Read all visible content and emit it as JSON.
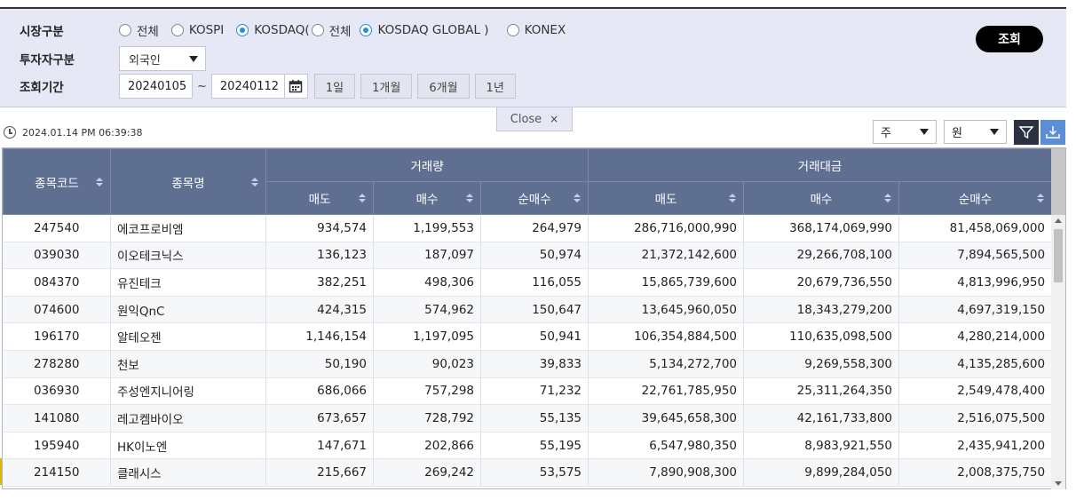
{
  "filters": {
    "market_label": "시장구분",
    "market_options": [
      {
        "label": "전체",
        "selected": false
      },
      {
        "label": "KOSPI",
        "selected": false
      },
      {
        "label": "KOSDAQ(",
        "selected": true
      },
      {
        "label": "전체",
        "selected": false
      },
      {
        "label": "KOSDAQ GLOBAL )",
        "selected": true
      },
      {
        "label": "KONEX",
        "selected": false
      }
    ],
    "investor_label": "투자자구분",
    "investor_value": "외국인",
    "period_label": "조회기간",
    "start_date": "20240105",
    "tilde": "~",
    "end_date": "20240112",
    "period_buttons": [
      "1일",
      "1개월",
      "6개월",
      "1년"
    ],
    "search_label": "조회"
  },
  "close_label": "Close",
  "close_symbol": "×",
  "timestamp": "2024.01.14 PM 06:39:38",
  "unit_period": "주",
  "unit_currency": "원",
  "table": {
    "headers": {
      "code": "종목코드",
      "name": "종목명",
      "volume_group": "거래량",
      "amount_group": "거래대금",
      "sell": "매도",
      "buy": "매수",
      "net": "순매수"
    },
    "rows": [
      {
        "code": "247540",
        "name": "에코프로비엠",
        "vol_sell": "934,574",
        "vol_buy": "1,199,553",
        "vol_net": "264,979",
        "amt_sell": "286,716,000,990",
        "amt_buy": "368,174,069,990",
        "amt_net": "81,458,069,000"
      },
      {
        "code": "039030",
        "name": "이오테크닉스",
        "vol_sell": "136,123",
        "vol_buy": "187,097",
        "vol_net": "50,974",
        "amt_sell": "21,372,142,600",
        "amt_buy": "29,266,708,100",
        "amt_net": "7,894,565,500"
      },
      {
        "code": "084370",
        "name": "유진테크",
        "vol_sell": "382,251",
        "vol_buy": "498,306",
        "vol_net": "116,055",
        "amt_sell": "15,865,739,600",
        "amt_buy": "20,679,736,550",
        "amt_net": "4,813,996,950"
      },
      {
        "code": "074600",
        "name": "원익QnC",
        "vol_sell": "424,315",
        "vol_buy": "574,962",
        "vol_net": "150,647",
        "amt_sell": "13,645,960,050",
        "amt_buy": "18,343,279,200",
        "amt_net": "4,697,319,150"
      },
      {
        "code": "196170",
        "name": "알테오젠",
        "vol_sell": "1,146,154",
        "vol_buy": "1,197,095",
        "vol_net": "50,941",
        "amt_sell": "106,354,884,500",
        "amt_buy": "110,635,098,500",
        "amt_net": "4,280,214,000"
      },
      {
        "code": "278280",
        "name": "천보",
        "vol_sell": "50,190",
        "vol_buy": "90,023",
        "vol_net": "39,833",
        "amt_sell": "5,134,272,700",
        "amt_buy": "9,269,558,300",
        "amt_net": "4,135,285,600"
      },
      {
        "code": "036930",
        "name": "주성엔지니어링",
        "vol_sell": "686,066",
        "vol_buy": "757,298",
        "vol_net": "71,232",
        "amt_sell": "22,761,785,950",
        "amt_buy": "25,311,264,350",
        "amt_net": "2,549,478,400"
      },
      {
        "code": "141080",
        "name": "레고켐바이오",
        "vol_sell": "673,657",
        "vol_buy": "728,792",
        "vol_net": "55,135",
        "amt_sell": "39,645,658,300",
        "amt_buy": "42,161,733,800",
        "amt_net": "2,516,075,500"
      },
      {
        "code": "195940",
        "name": "HK이노엔",
        "vol_sell": "147,671",
        "vol_buy": "202,866",
        "vol_net": "55,195",
        "amt_sell": "6,547,980,350",
        "amt_buy": "8,983,921,550",
        "amt_net": "2,435,941,200"
      },
      {
        "code": "214150",
        "name": "클래시스",
        "vol_sell": "215,667",
        "vol_buy": "269,242",
        "vol_net": "53,575",
        "amt_sell": "7,890,908,300",
        "amt_buy": "9,899,284,050",
        "amt_net": "2,008,375,750"
      }
    ]
  },
  "colors": {
    "panel_bg": "#e6e8f5",
    "header_bg": "#5f6f91",
    "radio_accent": "#2a8ed6",
    "search_btn_bg": "#000000",
    "icon_btn_bg": "#2b3140",
    "download_btn_bg": "#5b8ed6"
  },
  "icons": [
    "radio-icon",
    "chevron-down-icon",
    "calendar-icon",
    "close-icon",
    "clock-icon",
    "filter-icon",
    "download-icon",
    "sort-icon"
  ]
}
